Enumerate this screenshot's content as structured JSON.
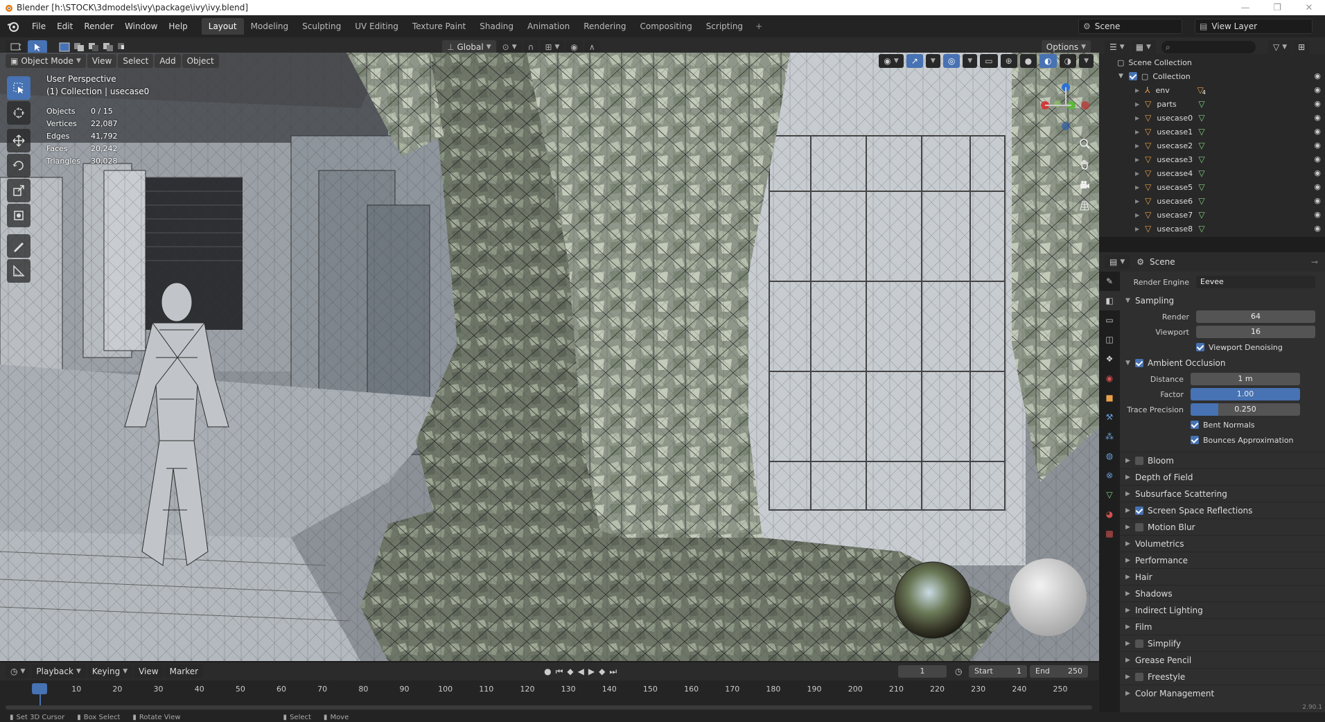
{
  "window": {
    "title": "Blender [h:\\STOCK\\3dmodels\\ivy\\package\\ivy\\ivy.blend]",
    "controls": [
      "—",
      "❐",
      "✕"
    ]
  },
  "menu": [
    "File",
    "Edit",
    "Render",
    "Window",
    "Help"
  ],
  "workspaces": [
    "Layout",
    "Modeling",
    "Sculpting",
    "UV Editing",
    "Texture Paint",
    "Shading",
    "Animation",
    "Rendering",
    "Compositing",
    "Scripting"
  ],
  "workspace_add": "+",
  "scene_name": "Scene",
  "view_layer": "View Layer",
  "viewport": {
    "transform_orientation": "Global",
    "options_label": "Options",
    "mode": "Object Mode",
    "header_menus": [
      "View",
      "Select",
      "Add",
      "Object"
    ],
    "perspective": "User Perspective",
    "collection_info": "(1) Collection | usecase0",
    "stats": [
      {
        "label": "Objects",
        "value": "0 / 15"
      },
      {
        "label": "Vertices",
        "value": "22,087"
      },
      {
        "label": "Edges",
        "value": "41,792"
      },
      {
        "label": "Faces",
        "value": "20,242"
      },
      {
        "label": "Triangles",
        "value": "30,028"
      }
    ],
    "tools": [
      "select-box-icon",
      "cursor-icon",
      "move-icon",
      "rotate-icon",
      "scale-icon",
      "transform-icon",
      "annotate-icon",
      "measure-icon"
    ]
  },
  "outliner": {
    "root": "Scene Collection",
    "collection": "Collection",
    "items": [
      "env",
      "parts",
      "usecase0",
      "usecase1",
      "usecase2",
      "usecase3",
      "usecase4",
      "usecase5",
      "usecase6",
      "usecase7",
      "usecase8"
    ],
    "env_badge": "4"
  },
  "properties": {
    "context": "Scene",
    "render_engine_label": "Render Engine",
    "render_engine": "Eevee",
    "sampling": {
      "title": "Sampling",
      "render_label": "Render",
      "render": "64",
      "viewport_label": "Viewport",
      "viewport": "16",
      "denoise_label": "Viewport Denoising"
    },
    "ao": {
      "title": "Ambient Occlusion",
      "distance_label": "Distance",
      "distance": "1 m",
      "factor_label": "Factor",
      "factor": "1.00",
      "factor_fill": 1.0,
      "trace_label": "Trace Precision",
      "trace": "0.250",
      "trace_fill": 0.25,
      "bent_normals": "Bent Normals",
      "bounces": "Bounces Approximation"
    },
    "panels": [
      {
        "label": "Bloom",
        "checkbox": true,
        "checked": false
      },
      {
        "label": "Depth of Field",
        "checkbox": false,
        "checked": false
      },
      {
        "label": "Subsurface Scattering",
        "checkbox": false,
        "checked": false
      },
      {
        "label": "Screen Space Reflections",
        "checkbox": true,
        "checked": true
      },
      {
        "label": "Motion Blur",
        "checkbox": true,
        "checked": false
      },
      {
        "label": "Volumetrics",
        "checkbox": false,
        "checked": false
      },
      {
        "label": "Performance",
        "checkbox": false,
        "checked": false
      },
      {
        "label": "Hair",
        "checkbox": false,
        "checked": false
      },
      {
        "label": "Shadows",
        "checkbox": false,
        "checked": false
      },
      {
        "label": "Indirect Lighting",
        "checkbox": false,
        "checked": false
      },
      {
        "label": "Film",
        "checkbox": false,
        "checked": false
      },
      {
        "label": "Simplify",
        "checkbox": true,
        "checked": false
      },
      {
        "label": "Grease Pencil",
        "checkbox": false,
        "checked": false
      },
      {
        "label": "Freestyle",
        "checkbox": true,
        "checked": false
      },
      {
        "label": "Color Management",
        "checkbox": false,
        "checked": false
      }
    ]
  },
  "timeline": {
    "menus": [
      "Playback",
      "Keying",
      "View",
      "Marker"
    ],
    "current_frame": "1",
    "start_label": "Start",
    "start": "1",
    "end_label": "End",
    "end": "250",
    "ticks": [
      "1",
      "10",
      "20",
      "30",
      "40",
      "50",
      "60",
      "70",
      "80",
      "90",
      "100",
      "110",
      "120",
      "130",
      "140",
      "150",
      "160",
      "170",
      "180",
      "190",
      "200",
      "210",
      "220",
      "230",
      "240",
      "250"
    ]
  },
  "statusbar": {
    "items": [
      "Set 3D Cursor",
      "Box Select",
      "Rotate View",
      "Select",
      "Move"
    ],
    "version": "2.90.1"
  },
  "colors": {
    "accent": "#4772b3",
    "mesh_orange": "#e8a04a",
    "data_green": "#7fd47f"
  }
}
